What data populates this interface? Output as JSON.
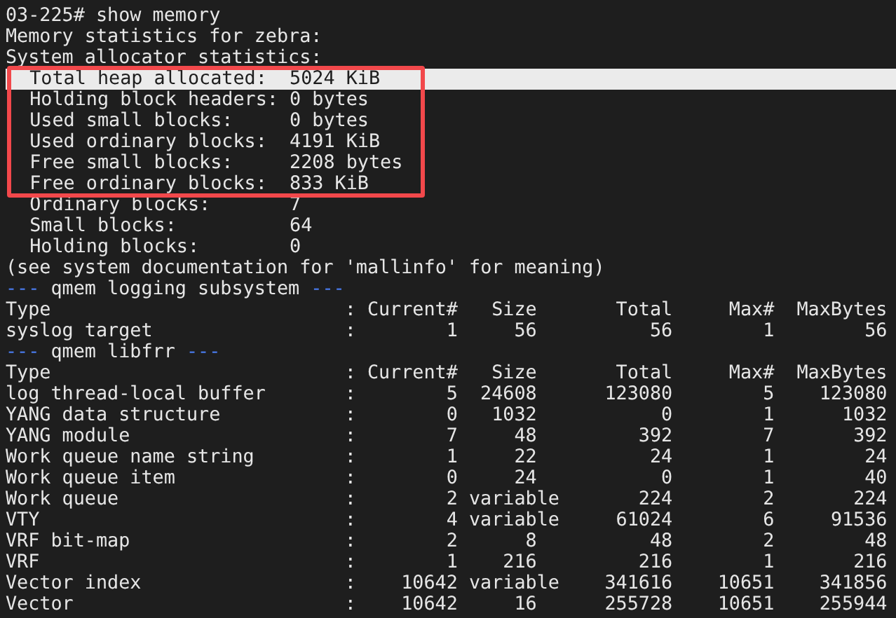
{
  "prompt": {
    "host": "03-225#",
    "command": "show memory"
  },
  "header_lines": [
    "Memory statistics for zebra:",
    "System allocator statistics:"
  ],
  "allocator_stats": [
    {
      "label": "Total heap allocated:",
      "value": "5024 KiB",
      "selected": true,
      "framed": true
    },
    {
      "label": "Holding block headers:",
      "value": "0 bytes",
      "selected": false,
      "framed": true
    },
    {
      "label": "Used small blocks:",
      "value": "0 bytes",
      "selected": false,
      "framed": true
    },
    {
      "label": "Used ordinary blocks:",
      "value": "4191 KiB",
      "selected": false,
      "framed": true
    },
    {
      "label": "Free small blocks:",
      "value": "2208 bytes",
      "selected": false,
      "framed": true
    },
    {
      "label": "Free ordinary blocks:",
      "value": "833 KiB",
      "selected": false,
      "framed": true
    },
    {
      "label": "Ordinary blocks:",
      "value": "7",
      "selected": false,
      "framed": false
    },
    {
      "label": "Small blocks:",
      "value": "64",
      "selected": false,
      "framed": false
    },
    {
      "label": "Holding blocks:",
      "value": "0",
      "selected": false,
      "framed": false
    }
  ],
  "note": "(see system documentation for 'mallinfo' for meaning)",
  "sections": [
    {
      "rule_left": "---",
      "title": "qmem logging subsystem",
      "rule_right": "---",
      "columns": [
        "Type",
        ":",
        "Current#",
        "Size",
        "Total",
        "Max#",
        "MaxBytes"
      ],
      "rows": [
        [
          "syslog target",
          ":",
          "1",
          "56",
          "56",
          "1",
          "56"
        ]
      ]
    },
    {
      "rule_left": "---",
      "title": "qmem libfrr",
      "rule_right": "---",
      "columns": [
        "Type",
        ":",
        "Current#",
        "Size",
        "Total",
        "Max#",
        "MaxBytes"
      ],
      "rows": [
        [
          "log thread-local buffer",
          ":",
          "5",
          "24608",
          "123080",
          "5",
          "123080"
        ],
        [
          "YANG data structure",
          ":",
          "0",
          "1032",
          "0",
          "1",
          "1032"
        ],
        [
          "YANG module",
          ":",
          "7",
          "48",
          "392",
          "7",
          "392"
        ],
        [
          "Work queue name string",
          ":",
          "1",
          "22",
          "24",
          "1",
          "24"
        ],
        [
          "Work queue item",
          ":",
          "0",
          "24",
          "0",
          "1",
          "40"
        ],
        [
          "Work queue",
          ":",
          "2",
          "variable",
          "224",
          "2",
          "224"
        ],
        [
          "VTY",
          ":",
          "4",
          "variable",
          "61024",
          "6",
          "91536"
        ],
        [
          "VRF bit-map",
          ":",
          "2",
          "8",
          "48",
          "2",
          "48"
        ],
        [
          "VRF",
          ":",
          "1",
          "216",
          "216",
          "1",
          "216"
        ],
        [
          "Vector index",
          ":",
          "10642",
          "variable",
          "341616",
          "10651",
          "341856"
        ],
        [
          "Vector",
          ":",
          "10642",
          "16",
          "255728",
          "10651",
          "255944"
        ]
      ]
    }
  ]
}
